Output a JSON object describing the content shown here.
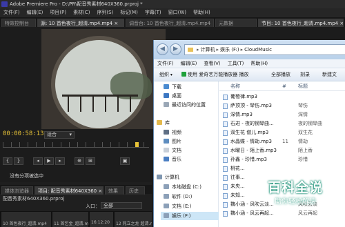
{
  "premiere": {
    "title": "Adobe Premiere Pro - D:\\PR\\配音秀素材640X360.prproj *",
    "menu": [
      "文件(F)",
      "编辑(E)",
      "项目(P)",
      "素材(C)",
      "序列(S)",
      "标记(M)",
      "字幕(T)",
      "窗口(W)",
      "帮助(H)"
    ],
    "tabs": [
      "特效控制台",
      "源: 10 首色夜行_超清.mp4.mp4 ×",
      "调音台: 10 首色夜行_超清.mp4.mp4",
      "元数据",
      "节目: 10 首色夜行_超清.mp4.mp4 ×"
    ],
    "timecode": "00:00:58:13",
    "fit_label": "适合",
    "no_clip": "没有分项被选中",
    "bottom_tabs": [
      "媒体浏览器",
      "项目: 配音秀素材640X360 ×",
      "效果",
      "历史"
    ],
    "project_name": "配音秀素材640X360.prproj",
    "entry_label": "入口：",
    "entry_value": "全部",
    "thumbs": [
      "10 首色夜行_超清.mp4",
      "11 首乞金_超清.mp4",
      "16:12:20",
      "12 死立之龙 超清.mp4"
    ]
  },
  "explorer": {
    "nav": {
      "back": "◀",
      "forward": "▶"
    },
    "address": [
      "计算机",
      "娱乐 (F:)",
      "CloudMusic"
    ],
    "menu": [
      "文件(F)",
      "编辑(E)",
      "查看(V)",
      "工具(T)",
      "帮助(H)"
    ],
    "toolbar": {
      "organize": "组织",
      "play": "使用 爱奇艺万能播放器 播放",
      "play_all": "全部播放",
      "burn": "刻录",
      "new_folder": "新建文"
    },
    "sidebar": [
      {
        "label": "下载",
        "color": "#4a8bd0"
      },
      {
        "label": "桌面",
        "color": "#3c77c2"
      },
      {
        "label": "最近访问的位置",
        "color": "#9aa7b6"
      },
      {
        "label": "库",
        "color": "#e4b94c",
        "section": true
      },
      {
        "label": "视频",
        "color": "#5f6f84"
      },
      {
        "label": "图片",
        "color": "#5e8dbf"
      },
      {
        "label": "文档",
        "color": "#c8cfd8"
      },
      {
        "label": "音乐",
        "color": "#4a7ec2"
      },
      {
        "label": "计算机",
        "color": "#7f96b0",
        "section": true
      },
      {
        "label": "本地磁盘 (C:)",
        "color": "#8ca0b8"
      },
      {
        "label": "软件 (D:)",
        "color": "#8ca0b8"
      },
      {
        "label": "文档 (E:)",
        "color": "#8ca0b8"
      },
      {
        "label": "娱乐 (F:)",
        "color": "#8ca0b8",
        "selected": true
      }
    ],
    "columns": {
      "name": "名称",
      "num": "#",
      "title": "标题"
    },
    "files": [
      {
        "name": "葡萄律.mp3",
        "num": "",
        "title": ""
      },
      {
        "name": "萨顶顶 - 琴伤.mp3",
        "num": "",
        "title": "琴伤"
      },
      {
        "name": "深情.mp3",
        "num": "",
        "title": "深情"
      },
      {
        "name": "石进 - 夜的钢琴曲...",
        "num": "",
        "title": "夜的钢琴曲"
      },
      {
        "name": "双生花 僧儿.mp3",
        "num": "",
        "title": "双生花"
      },
      {
        "name": "水晶蝶 - 情劫.mp3",
        "num": "11",
        "title": "情劫"
      },
      {
        "name": "水曜日 - 陌上香.mp3",
        "num": "",
        "title": "陌上香"
      },
      {
        "name": "孙鑫 - 珍惜.mp3",
        "num": "",
        "title": "珍惜"
      },
      {
        "name": "桃花...",
        "num": "",
        "title": ""
      },
      {
        "name": "往事...",
        "num": "",
        "title": ""
      },
      {
        "name": "未央...",
        "num": "",
        "title": ""
      },
      {
        "name": "未知...",
        "num": "",
        "title": ""
      },
      {
        "name": "魏小涵 - 风吹云淡...",
        "num": "",
        "title": "风吹云淡"
      },
      {
        "name": "魏小涵 - 风云再起...",
        "num": "",
        "title": "风云再起"
      }
    ]
  },
  "watermark": {
    "big": "百科全说",
    "small": "助你轻松解决"
  }
}
